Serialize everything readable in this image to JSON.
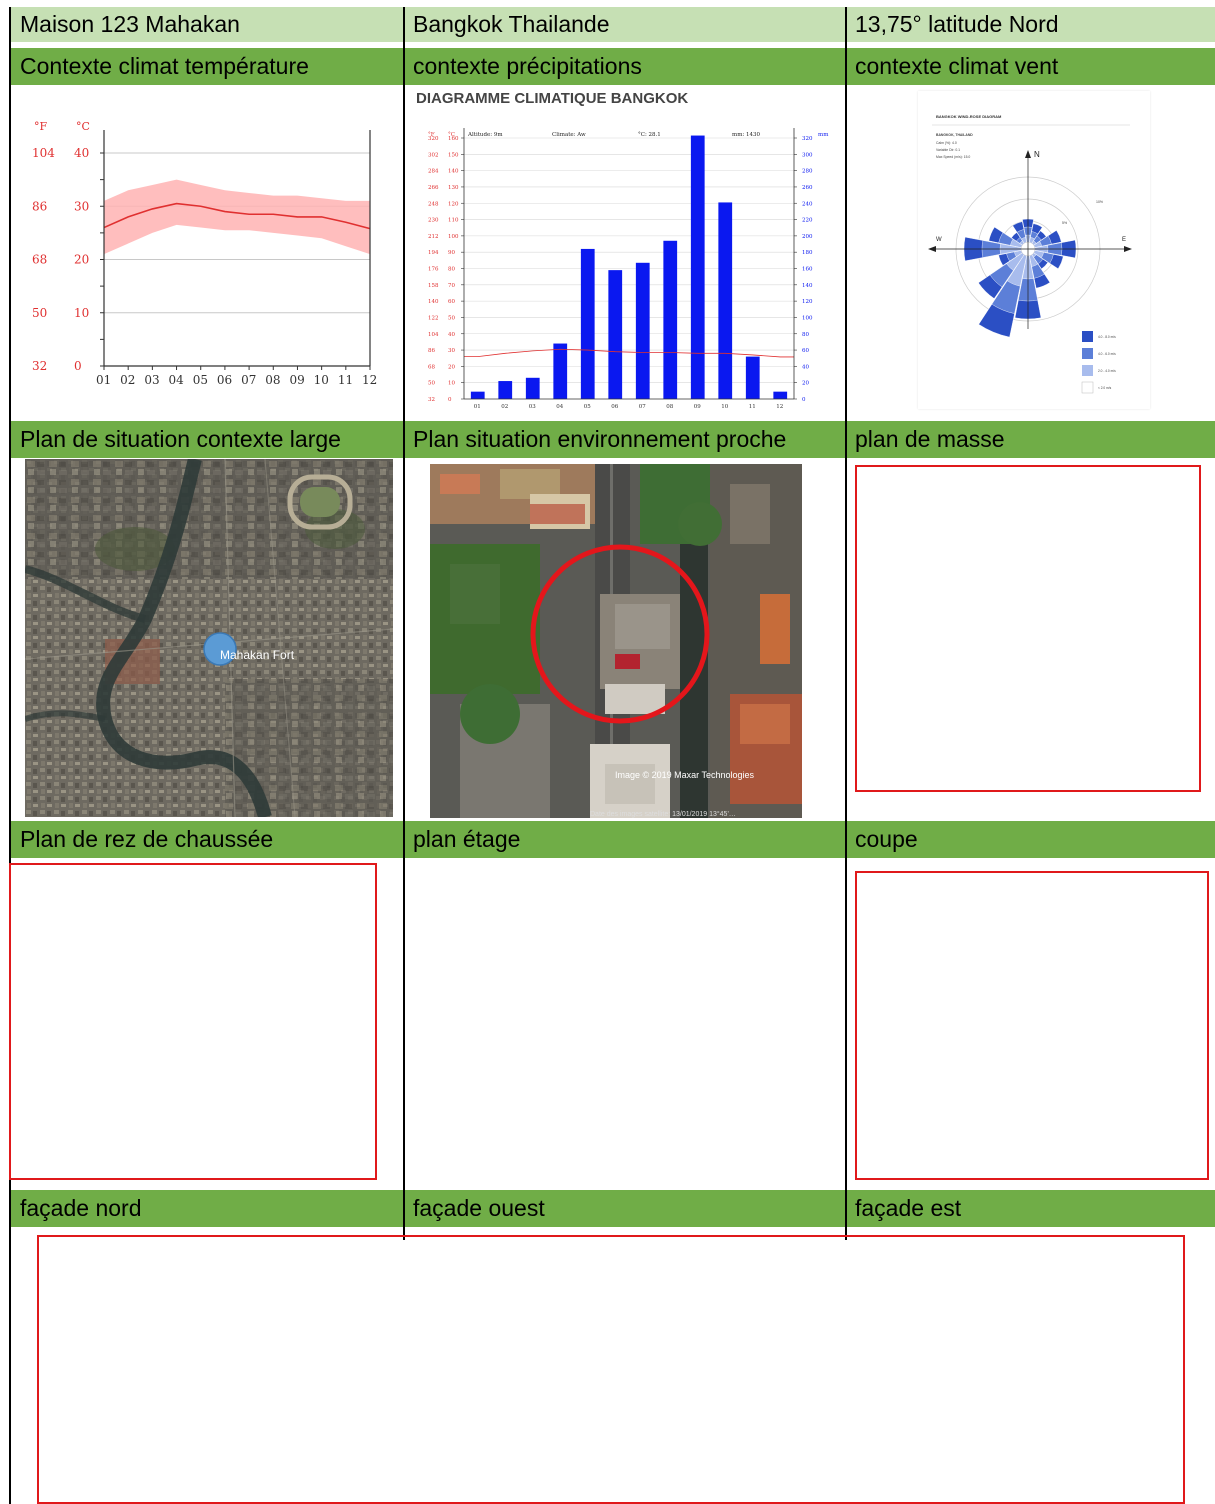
{
  "title_row": [
    "Maison 123 Mahakan",
    "Bangkok Thailande",
    "13,75° latitude Nord"
  ],
  "section_headers": {
    "row1": [
      "Contexte climat température",
      "contexte précipitations",
      "contexte climat vent"
    ],
    "row2": [
      "Plan de situation contexte large",
      "Plan situation environnement proche",
      "plan  de masse"
    ],
    "row3": [
      "Plan de rez de chaussée",
      "plan étage",
      "coupe"
    ],
    "row4": [
      "façade nord",
      "façade ouest",
      "façade est"
    ]
  },
  "colors": {
    "header_light": "#c6e0b4",
    "header_green": "#70ad47",
    "frame_red": "#e0191b",
    "temp_red": "#ff4d4d",
    "precip_blue": "#0a18f0"
  },
  "temperature_chart": {
    "chart_data": {
      "type": "line",
      "categories": [
        "01",
        "02",
        "03",
        "04",
        "05",
        "06",
        "07",
        "08",
        "09",
        "10",
        "11",
        "12"
      ],
      "series": [
        {
          "values": [
            26,
            28,
            29.5,
            30.5,
            30,
            29,
            28.5,
            28.5,
            28,
            28,
            27,
            25.8
          ]
        },
        {
          "values": [
            31,
            33,
            34,
            35,
            34,
            33,
            32.5,
            32,
            32,
            31.5,
            31,
            31
          ]
        },
        {
          "values": [
            21,
            23,
            25,
            26.5,
            26,
            25.5,
            25.5,
            25,
            24.5,
            24,
            22.5,
            21
          ]
        }
      ],
      "left_unit": "°F",
      "right_unit": "°C",
      "f_ticks": [
        "104",
        "86",
        "68",
        "50",
        "32"
      ],
      "c_ticks": [
        "40",
        "30",
        "20",
        "10",
        "0"
      ],
      "ylim": [
        0,
        40
      ]
    }
  },
  "precip_chart": {
    "heading": "DIAGRAMME CLIMATIQUE BANGKOK",
    "info": {
      "altitude": "Altitude: 9m",
      "climate": "Climate: Aw",
      "temp": "°C: 28.1",
      "mm": "mm: 1430"
    },
    "chart_data": {
      "type": "bar",
      "categories": [
        "01",
        "02",
        "03",
        "04",
        "05",
        "06",
        "07",
        "08",
        "09",
        "10",
        "11",
        "12"
      ],
      "values": [
        9,
        22,
        26,
        68,
        184,
        158,
        167,
        194,
        323,
        241,
        52,
        9
      ],
      "temp_values": [
        26,
        28,
        29.5,
        30.5,
        30,
        29,
        28.5,
        28.5,
        28,
        28,
        27,
        25.8
      ],
      "units": {
        "f": "°F",
        "c": "°C",
        "mm": "mm"
      },
      "f_ticks": [
        "320",
        "302",
        "284",
        "266",
        "248",
        "230",
        "212",
        "194",
        "176",
        "158",
        "140",
        "122",
        "104",
        "86",
        "68",
        "50",
        "32"
      ],
      "c_ticks": [
        "160",
        "150",
        "140",
        "130",
        "120",
        "110",
        "100",
        "90",
        "80",
        "70",
        "60",
        "50",
        "40",
        "30",
        "20",
        "10",
        "0"
      ],
      "mm_ticks": [
        "320",
        "300",
        "280",
        "260",
        "240",
        "220",
        "200",
        "180",
        "160",
        "140",
        "120",
        "100",
        "80",
        "60",
        "40",
        "20",
        "0"
      ],
      "ylim": [
        0,
        320
      ]
    }
  },
  "wind_rose": {
    "title": "BANGKOK WIND-ROSE DIAGRAM",
    "location": "BANGKOK, THAILAND",
    "stats": [
      "Calm (%): 4.0",
      "Variable Dir: 0.1",
      "Max Speed (m/s): 15.0"
    ],
    "compass": {
      "n": "N",
      "w": "W",
      "e": "E"
    },
    "ring_labels": [
      "10%",
      "5%"
    ],
    "legend": [
      "4.0 - 8.0 m/s",
      "4.0 - 6.0 m/s",
      "2.0 - 4.0 m/s",
      "< 2.0 m/s"
    ]
  },
  "map_large": {
    "label": "Mahakan Fort"
  },
  "map_close": {
    "credit": "Image © 2019 Maxar Technologies",
    "bottom_text": "Date des images satellite: 13/01/2019   13°45'…"
  }
}
